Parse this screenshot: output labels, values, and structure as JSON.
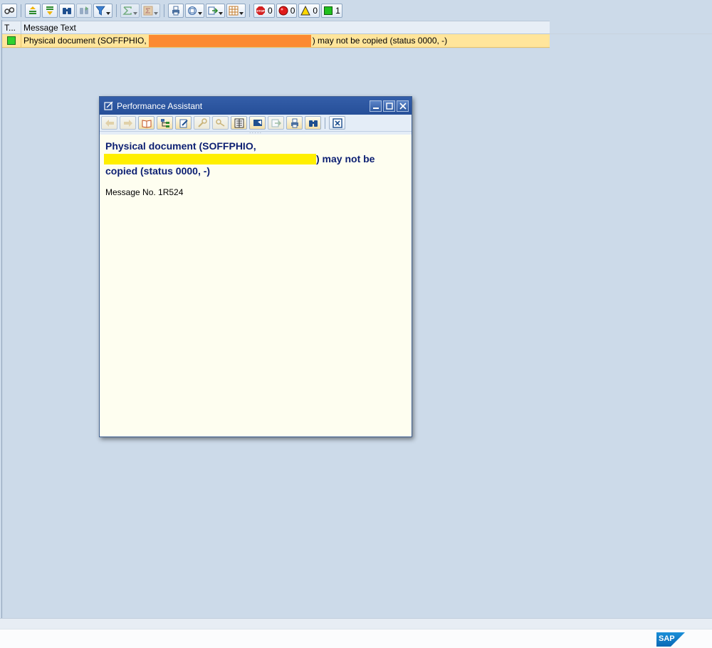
{
  "toolbar": {
    "counters": {
      "stop": "0",
      "error": "0",
      "warning": "0",
      "success": "1"
    }
  },
  "table": {
    "col_type": "T...",
    "col_message": "Message Text",
    "rows": [
      {
        "text_before": "Physical document (SOFFPHIO,",
        "text_after": ") may not be copied (status 0000, -)"
      }
    ]
  },
  "popup": {
    "title": "Performance Assistant",
    "message_line1": "Physical document (SOFFPHIO,",
    "message_line2_after": ") may not be",
    "message_line3": "copied (status 0000, -)",
    "message_number": "Message No. 1R524"
  },
  "footer": {
    "logo": "SAP"
  }
}
